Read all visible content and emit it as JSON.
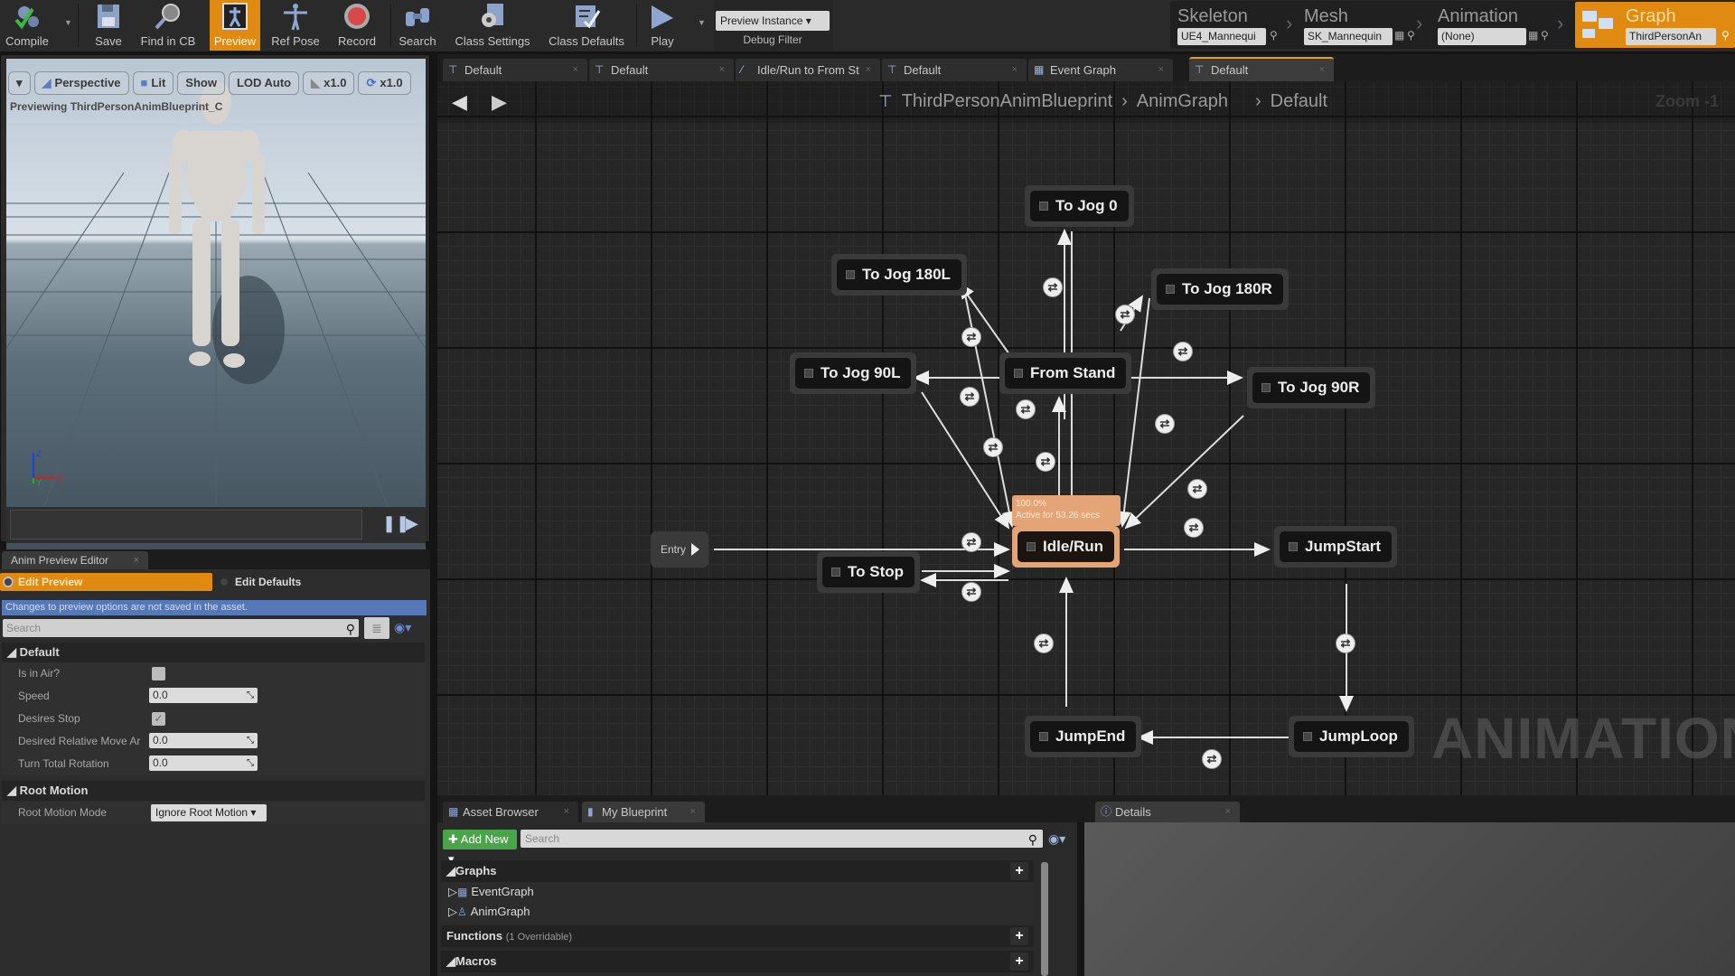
{
  "toolbar": {
    "buttons": [
      {
        "id": "compile",
        "label": "Compile",
        "icon": "compile-gears-check-icon"
      },
      {
        "id": "save",
        "label": "Save",
        "icon": "floppy-disk-icon"
      },
      {
        "id": "find_in_cb",
        "label": "Find in CB",
        "icon": "magnifier-icon"
      },
      {
        "id": "preview",
        "label": "Preview",
        "icon": "preview-mannequin-icon",
        "active": true
      },
      {
        "id": "ref_pose",
        "label": "Ref Pose",
        "icon": "ref-pose-icon"
      },
      {
        "id": "record",
        "label": "Record",
        "icon": "record-icon"
      },
      {
        "id": "search",
        "label": "Search",
        "icon": "binoculars-icon"
      },
      {
        "id": "class_settings",
        "label": "Class Settings",
        "icon": "class-settings-icon"
      },
      {
        "id": "class_defaults",
        "label": "Class Defaults",
        "icon": "class-defaults-icon"
      },
      {
        "id": "play",
        "label": "Play",
        "icon": "play-icon"
      }
    ],
    "debug_filter": {
      "value": "Preview Instance ▾",
      "label": "Debug Filter"
    }
  },
  "modes": [
    {
      "label": "Skeleton",
      "value": "UE4_Mannequi"
    },
    {
      "label": "Mesh",
      "value": "SK_Mannequin"
    },
    {
      "label": "Animation",
      "value": "(None)"
    },
    {
      "label": "Graph",
      "value": "ThirdPersonAn",
      "active": true
    }
  ],
  "viewport": {
    "buttons": [
      "▾",
      "Perspective",
      "Lit",
      "Show",
      "LOD Auto",
      "x1.0",
      "x1.0"
    ],
    "preview_text": "Previewing ThirdPersonAnimBlueprint_C",
    "axis": {
      "z": "Z",
      "x": "X",
      "y": "Y"
    }
  },
  "anim_preview": {
    "tab": "Anim Preview Editor",
    "edit_preview": "Edit Preview",
    "edit_defaults": "Edit Defaults",
    "info": "Changes to preview options are not saved in the asset.",
    "search_placeholder": "Search",
    "categories": {
      "default": "Default",
      "root_motion": "Root Motion"
    },
    "props": [
      {
        "label": "Is in Air?",
        "type": "checkbox",
        "checked": false
      },
      {
        "label": "Speed",
        "type": "number",
        "value": "0.0"
      },
      {
        "label": "Desires Stop",
        "type": "checkbox",
        "checked": true
      },
      {
        "label": "Desired Relative Move Ar",
        "type": "number",
        "value": "0.0"
      },
      {
        "label": "Turn Total Rotation",
        "type": "number",
        "value": "0.0"
      }
    ],
    "root_motion_mode": {
      "label": "Root Motion Mode",
      "value": "Ignore Root Motion ▾"
    }
  },
  "graph_tabs": [
    {
      "label": "Default"
    },
    {
      "label": "Default"
    },
    {
      "label": "Idle/Run to From St"
    },
    {
      "label": "Default"
    },
    {
      "label": "Event Graph"
    },
    {
      "label": "Default",
      "active": true
    }
  ],
  "graph": {
    "breadcrumb": [
      "ThirdPersonAnimBlueprint",
      "›",
      "AnimGraph",
      "›",
      "Default"
    ],
    "zoom": "Zoom -1",
    "watermark": "ANIMATION",
    "entry": "Entry",
    "active_tip": {
      "percent": "100.0%",
      "active": "Active for 53.26 secs"
    },
    "states": [
      {
        "id": "to_jog_0",
        "label": "To Jog 0"
      },
      {
        "id": "to_jog_180l",
        "label": "To Jog 180L"
      },
      {
        "id": "to_jog_180r",
        "label": "To Jog 180R"
      },
      {
        "id": "to_jog_90l",
        "label": "To Jog 90L"
      },
      {
        "id": "from_stand",
        "label": "From Stand"
      },
      {
        "id": "to_jog_90r",
        "label": "To Jog 90R"
      },
      {
        "id": "idle_run",
        "label": "Idle/Run",
        "active": true
      },
      {
        "id": "to_stop",
        "label": "To Stop"
      },
      {
        "id": "jump_start",
        "label": "JumpStart"
      },
      {
        "id": "jump_end",
        "label": "JumpEnd"
      },
      {
        "id": "jump_loop",
        "label": "JumpLoop"
      }
    ]
  },
  "bottom_tabs": [
    {
      "label": "Asset Browser"
    },
    {
      "label": "My Blueprint",
      "active": true
    },
    {
      "label": "Details"
    }
  ],
  "my_blueprint": {
    "add_new": "Add New ▾",
    "search_placeholder": "Search",
    "sections": {
      "graphs": "Graphs",
      "functions": "Functions",
      "functions_sub": "(1 Overridable)",
      "macros": "Macros"
    },
    "graphs": [
      "EventGraph",
      "AnimGraph"
    ]
  }
}
